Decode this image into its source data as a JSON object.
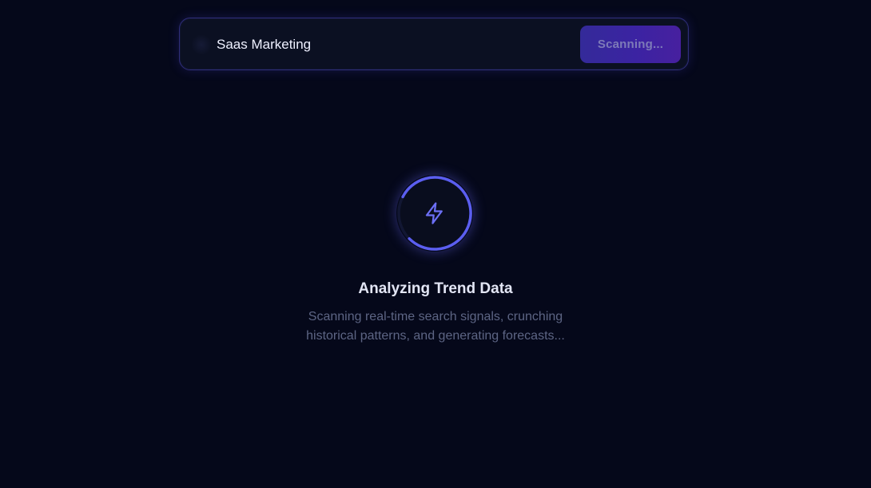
{
  "search": {
    "value": "Saas Marketing",
    "button_label": "Scanning..."
  },
  "loader": {
    "icon": "bolt-icon",
    "ring_color": "#6366f1"
  },
  "status": {
    "title": "Analyzing Trend Data",
    "description_line1": "Scanning real-time search signals, crunching",
    "description_line2": "historical patterns, and generating forecasts..."
  },
  "colors": {
    "background": "#05081a",
    "accent": "#6366f1",
    "button_gradient_start": "#342a99",
    "button_gradient_end": "#47209f"
  }
}
